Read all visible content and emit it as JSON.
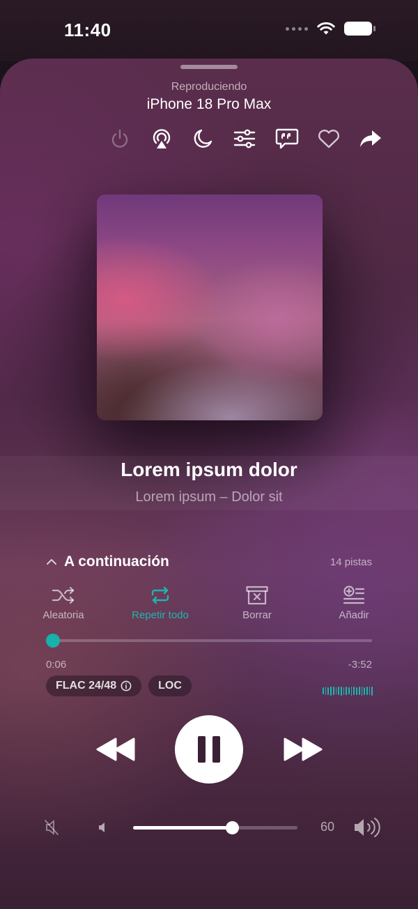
{
  "status_bar": {
    "time": "11:40",
    "icons": [
      "cellular-dots-icon",
      "wifi-icon",
      "battery-icon"
    ]
  },
  "header": {
    "label": "Reproduciendo",
    "device": "iPhone 18 Pro Max"
  },
  "toolbar": {
    "icons": [
      "power-icon",
      "airplay-icon",
      "sleep-timer-icon",
      "equalizer-icon",
      "lyrics-icon",
      "favorite-icon",
      "share-icon"
    ]
  },
  "song": {
    "title": "Lorem ipsum dolor",
    "subtitle": "Lorem ipsum – Dolor sit"
  },
  "up_next": {
    "title": "A continuación",
    "count": "14 pistas"
  },
  "actions": [
    {
      "label": "Aleatoria",
      "icon": "shuffle-icon"
    },
    {
      "label": "Repetir todo",
      "icon": "repeat-icon",
      "active": true
    },
    {
      "label": "Borrar",
      "icon": "clear-queue-icon"
    },
    {
      "label": "Añadir",
      "icon": "add-to-queue-icon"
    }
  ],
  "playback": {
    "elapsed": "0:06",
    "remaining": "-3:52",
    "progress": 0.022
  },
  "badges": {
    "format": "FLAC 24/48",
    "source": "LOC"
  },
  "volume": {
    "value": "60",
    "level": 0.6
  },
  "colors": {
    "accent": "#1fb5b0",
    "play_icon": "#3a2034"
  }
}
